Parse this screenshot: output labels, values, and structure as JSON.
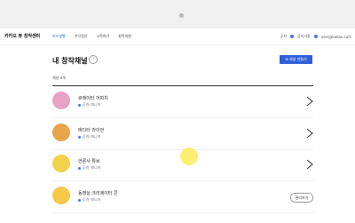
{
  "browser": {
    "indicator": "loading-dot"
  },
  "nav": {
    "brand": "카카오 뷰 창작센터",
    "menu": [
      "보드발행",
      "수익정산",
      "시작하기",
      "창작지원"
    ],
    "active_index": 0,
    "notice": "공지",
    "link2": "공지사항",
    "account": "user@kakao.com"
  },
  "page": {
    "title": "내 창작채널",
    "help_icon": "question-circle-icon",
    "create_button": "채널 만들기",
    "count": "채널 4개"
  },
  "channels": [
    {
      "name": "큐레이터 어피치",
      "status": "공개",
      "role": "매니저",
      "action": "chevron",
      "avatar_color": "#e7a3c4"
    },
    {
      "name": "에디터 라이언",
      "status": "공개",
      "role": "매니저",
      "action": "chevron",
      "avatar_color": "#e8a64a"
    },
    {
      "name": "언론사 튜브",
      "status": "공개",
      "role": "매니저",
      "action": "chevron",
      "avatar_color": "#f2d24a"
    },
    {
      "name": "동영상 크리에이터 콘",
      "status": "공개",
      "role": "매니저",
      "action": "button",
      "action_label": "관리하기",
      "avatar_color": "#f5c84a"
    }
  ],
  "colors": {
    "accent": "#2f5fd8",
    "status_dot": "#4a73e8",
    "cursor": "#ffeb5a"
  }
}
